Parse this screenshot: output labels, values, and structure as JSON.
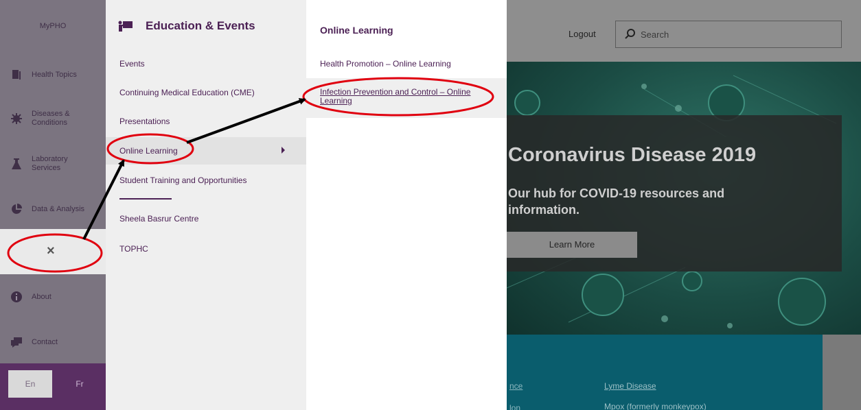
{
  "header": {
    "logout_label": "Logout",
    "search_placeholder": "Search"
  },
  "rail": {
    "myph_label": "MyPHO",
    "items": [
      {
        "label": "Health Topics",
        "icon": "book-icon"
      },
      {
        "label": "Diseases &\nConditions",
        "icon": "virus-icon"
      },
      {
        "label": "Laboratory\nServices",
        "icon": "flask-icon"
      },
      {
        "label": "Data & Analysis",
        "icon": "pie-chart-icon"
      },
      {
        "label": "About",
        "icon": "info-icon"
      },
      {
        "label": "Contact",
        "icon": "chat-icon"
      }
    ],
    "close_label": "×",
    "lang_en": "En",
    "lang_fr": "Fr"
  },
  "menu": {
    "heading": "Education & Events",
    "items": [
      "Events",
      "Continuing Medical Education (CME)",
      "Presentations",
      "Online Learning",
      "Student Training and Opportunities",
      "Sheela Basrur Centre",
      "TOPHC"
    ]
  },
  "submenu": {
    "heading": "Online Learning",
    "items": [
      "Health Promotion – Online Learning",
      "Infection Prevention and Control – Online Learning"
    ]
  },
  "hero": {
    "title": "Coronavirus Disease 2019",
    "subtitle": "Our hub for COVID-19 resources and information.",
    "button_label": "Learn More"
  },
  "band": {
    "links": [
      "nce",
      "lon",
      "Lyme Disease",
      "Mpox (formerly monkeypox)"
    ]
  },
  "colors": {
    "purple_dark": "#4b2054",
    "annotation_red": "#e0000f",
    "hero_teal": "#1b4c44",
    "band_teal": "#0a5d6d"
  }
}
